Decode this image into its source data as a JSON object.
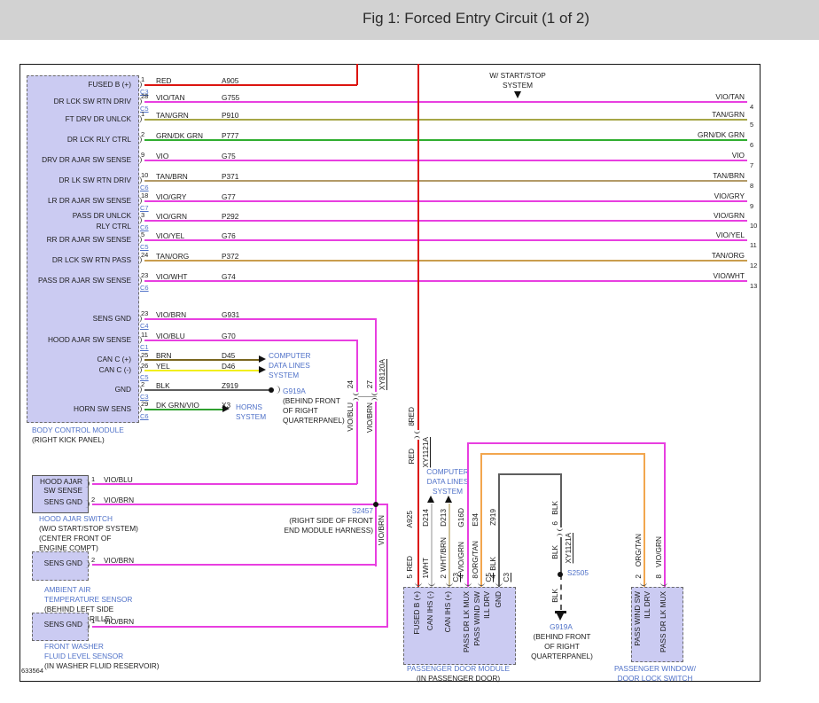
{
  "title": "Fig 1: Forced Entry Circuit (1 of 2)",
  "drawing_number": "633564",
  "colors": {
    "title_bar_bg": "#d2d2d2",
    "component_fill": "#cbcbf2",
    "label_blue": "#4f71c8",
    "text_black": "#1c1c1c",
    "wire": {
      "red": "#dc1410",
      "vio": "#e83fe0",
      "tan_grn": "#a6a647",
      "grn_dk_grn": "#2fae2f",
      "tan_brn": "#b39a67",
      "tan_org": "#c99d4d",
      "brn": "#7a661f",
      "yel": "#f2ef1d",
      "blk": "#5e5e5e",
      "dk_grn_vio": "#2fa02f",
      "wht": "#c9c9c9",
      "wht_brn": "#d0c49c",
      "org_tan": "#f2a64e"
    }
  },
  "bcm": {
    "caption_blue": "BODY CONTROL MODULE",
    "caption_black": "(RIGHT KICK PANEL)",
    "pins": [
      {
        "label": "FUSED B (+)",
        "pin": "1",
        "conn": "C3",
        "color": "RED",
        "circuit": "A905"
      },
      {
        "label": "DR LCK SW RTN DRIV",
        "pin": "28",
        "conn": "C5",
        "color": "VIO/TAN",
        "circuit": "G755",
        "exit": "4"
      },
      {
        "label": "FT DRV DR UNLCK",
        "pin": "1",
        "color": "TAN/GRN",
        "circuit": "P910",
        "exit": "5"
      },
      {
        "label": "DR LCK RLY CTRL",
        "pin": "2",
        "color": "GRN/DK GRN",
        "circuit": "P777",
        "exit": "6"
      },
      {
        "label": "DRV DR AJAR SW SENSE",
        "pin": "9",
        "color": "VIO",
        "circuit": "G75",
        "exit": "7"
      },
      {
        "label": "DR LK SW RTN DRIV",
        "pin": "10",
        "conn": "C6",
        "color": "TAN/BRN",
        "circuit": "P371",
        "exit": "8"
      },
      {
        "label": "LR DR AJAR SW SENSE",
        "pin": "18",
        "conn": "C7",
        "color": "VIO/GRY",
        "circuit": "G77",
        "exit": "9"
      },
      {
        "label": "PASS DR UNLCK",
        "label2": "RLY CTRL",
        "pin": "3",
        "conn": "C6",
        "color": "VIO/GRN",
        "circuit": "P292",
        "exit": "10"
      },
      {
        "label": "RR DR AJAR SW SENSE",
        "pin": "5",
        "conn": "C5",
        "color": "VIO/YEL",
        "circuit": "G76",
        "exit": "11"
      },
      {
        "label": "DR LCK SW RTN PASS",
        "pin": "24",
        "color": "TAN/ORG",
        "circuit": "P372",
        "exit": "12"
      },
      {
        "label": "PASS DR AJAR SW SENSE",
        "pin": "23",
        "conn": "C6",
        "color": "VIO/WHT",
        "circuit": "G74",
        "exit": "13"
      },
      {
        "label": "SENS GND",
        "pin": "23",
        "conn": "C4",
        "color": "VIO/BRN",
        "circuit": "G931"
      },
      {
        "label": "HOOD AJAR SW SENSE",
        "pin": "11",
        "conn": "C1",
        "color": "VIO/BLU",
        "circuit": "G70"
      },
      {
        "label": "CAN C (+)",
        "pin": "25",
        "color": "BRN",
        "circuit": "D45"
      },
      {
        "label": "CAN C (-)",
        "pin": "26",
        "conn": "C5",
        "color": "YEL",
        "circuit": "D46"
      },
      {
        "label": "GND",
        "pin": "2",
        "conn": "C3",
        "color": "BLK",
        "circuit": "Z919"
      },
      {
        "label": "HORN SW SENS",
        "pin": "29",
        "conn": "C6",
        "color": "DK GRN/VIO",
        "circuit": "X3"
      }
    ]
  },
  "notes": {
    "start_stop": [
      "W/ START/STOP",
      "SYSTEM"
    ],
    "computer_data_left": [
      "COMPUTER",
      "DATA LINES",
      "SYSTEM"
    ],
    "horns": [
      "HORNS",
      "SYSTEM"
    ],
    "computer_data_mid": [
      "COMPUTER",
      "DATA LINES",
      "SYSTEM"
    ]
  },
  "grounds": {
    "g919a_top": {
      "id": "G919A",
      "loc": [
        "(BEHIND FRONT",
        "OF RIGHT",
        "QUARTERPANEL)"
      ]
    },
    "g919a_bottom": {
      "id": "G919A",
      "loc": [
        "(BEHIND FRONT",
        "OF RIGHT",
        "QUARTERPANEL)"
      ]
    }
  },
  "splices": {
    "s2457": {
      "id": "S2457",
      "loc": [
        "(RIGHT SIDE OF FRONT",
        "END MODULE HARNESS)"
      ]
    },
    "s2505": {
      "id": "S2505"
    }
  },
  "inline_connectors": {
    "xy8120a": {
      "id": "XY8120A",
      "pin_left": "24",
      "pin_right": "27",
      "color_left": "VIO/BLU",
      "color_right": "VIO/BRN"
    },
    "xy1121a_red": {
      "id": "XY1121A",
      "pin": "8"
    },
    "xy1121a_blk": {
      "id": "XY1121A",
      "pin": "6"
    }
  },
  "hood_switch": {
    "pins": [
      {
        "row1": "HOOD AJAR",
        "row2": "SW SENSE",
        "pin": "1",
        "color": "VIO/BLU"
      },
      {
        "row1": "SENS GND",
        "pin": "2",
        "color": "VIO/BRN"
      }
    ],
    "caption_blue": [
      "HOOD AJAR SWITCH"
    ],
    "caption_black": [
      "(W/O START/STOP SYSTEM)",
      "(CENTER FRONT OF",
      "ENGINE COMPT)"
    ]
  },
  "ambient_sensor": {
    "pin_label": "SENS GND",
    "pin": "2",
    "color": "VIO/BRN",
    "caption_blue": [
      "AMBIENT AIR",
      "TEMPERATURE SENSOR"
    ],
    "caption_black": [
      "(BEHIND LEFT SIDE",
      "OF FRONT GRILLE)"
    ]
  },
  "washer_sensor": {
    "pin_label": "SENS GND",
    "pin": "1",
    "color": "VIO/BRN",
    "caption_blue": [
      "FRONT WASHER",
      "FLUID LEVEL SENSOR"
    ],
    "caption_black": [
      "(IN WASHER FLUID RESERVOIR)"
    ]
  },
  "door_module": {
    "caption_blue": "PASSENGER DOOR MODULE",
    "caption_black": "(IN PASSENGER DOOR)",
    "pins": [
      {
        "label": "FUSED B (+)",
        "pin": "5",
        "color": "RED",
        "circuit": "A925"
      },
      {
        "label": "CAN IHS (-)",
        "pin": "1",
        "color": "WHT",
        "circuit": "D214"
      },
      {
        "label": "CAN IHS (+)",
        "pin": "2",
        "conn": "C3",
        "color": "WHT/BRN",
        "circuit": "D213"
      },
      {
        "label": "PASS DR LK MUX",
        "pin": "4",
        "color": "VIO/GRN",
        "circuit": "G16D"
      },
      {
        "label": "PASS WIND SW",
        "label2": "ILL DRV",
        "pin": "8",
        "conn": "C5",
        "color": "ORG/TAN",
        "circuit": "E34"
      },
      {
        "label": "GND",
        "pin": "4",
        "conn": "C3",
        "color": "BLK",
        "circuit": "Z919"
      }
    ]
  },
  "window_switch": {
    "caption_blue": [
      "PASSENGER WINDOW/",
      "DOOR LOCK SWITCH"
    ],
    "pins": [
      {
        "label": "PASS WIND SW",
        "label2": "ILL DRV",
        "pin": "2",
        "color": "ORG/TAN"
      },
      {
        "label": "PASS DR LK MUX",
        "pin": "8",
        "color": "VIO/GRN"
      }
    ]
  }
}
